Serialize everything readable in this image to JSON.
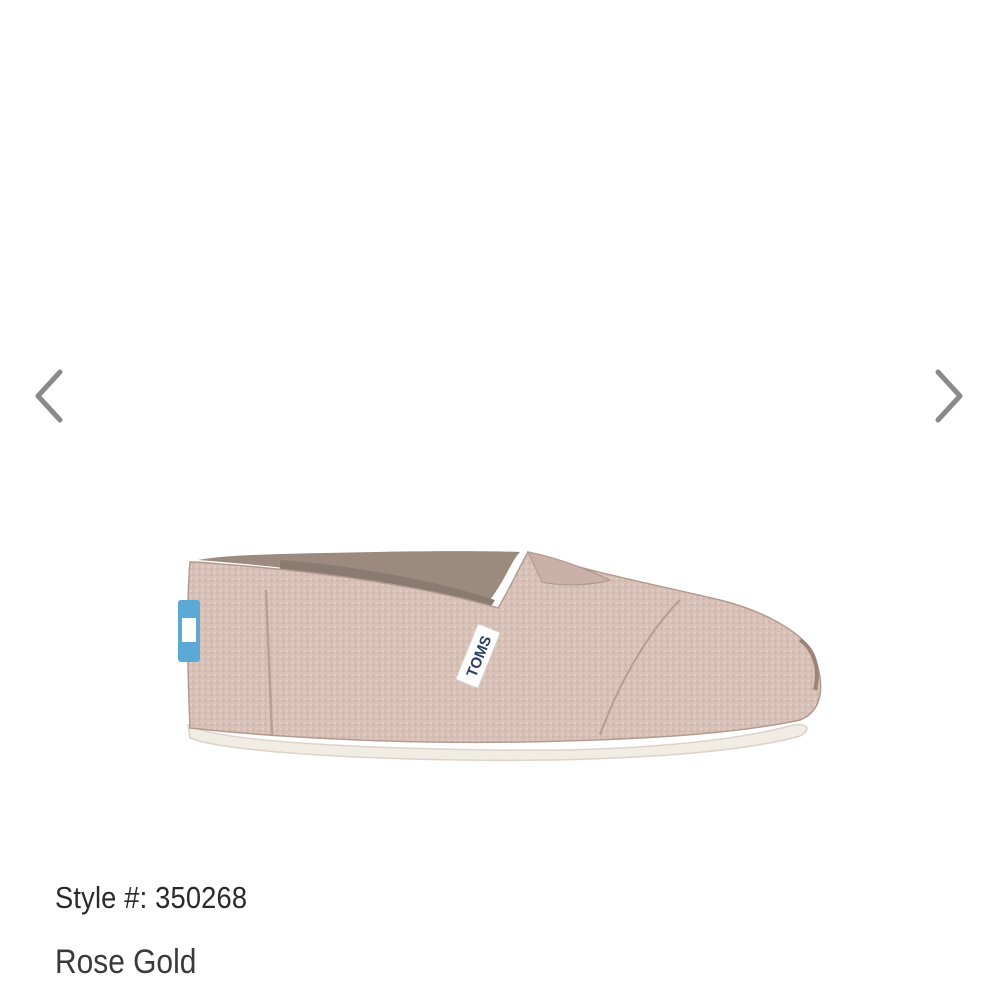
{
  "carousel": {
    "prev_icon": "chevron-left-icon",
    "next_icon": "chevron-right-icon",
    "image": {
      "label_text": "TOMS",
      "colors": {
        "upper": "#d9c2b8",
        "upper_shadow": "#bfa79e",
        "sole": "#f1ece4",
        "lining": "#9c8a7e",
        "heel_tab": "#5aa9d6"
      }
    }
  },
  "product": {
    "style_text": "Style #: 350268",
    "color_name": "Rose Gold"
  },
  "colors": {
    "arrow": "#8a8a8a",
    "text": "#2a2a2a"
  }
}
